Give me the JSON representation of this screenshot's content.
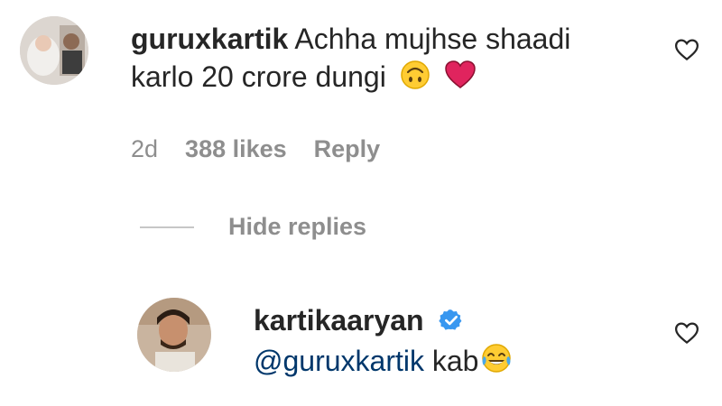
{
  "comment": {
    "username": "guruxkartik",
    "text_line1": "Achha mujhse shaadi",
    "text_line2": "karlo 20 crore dungi",
    "emojis": [
      "upside-down-face-icon",
      "red-heart-icon"
    ],
    "time": "2d",
    "likes": "388 likes",
    "reply_label": "Reply"
  },
  "replies_toggle": {
    "label": "Hide replies"
  },
  "reply": {
    "username": "kartikaaryan",
    "verified": true,
    "mention": "@guruxkartik",
    "text": "kab",
    "emoji": "face-with-tears-of-joy-icon"
  },
  "colors": {
    "text": "#262626",
    "muted": "#8e8e8e",
    "mention": "#00376b",
    "verified": "#3897f0",
    "heart_emoji": "#e0245e"
  }
}
